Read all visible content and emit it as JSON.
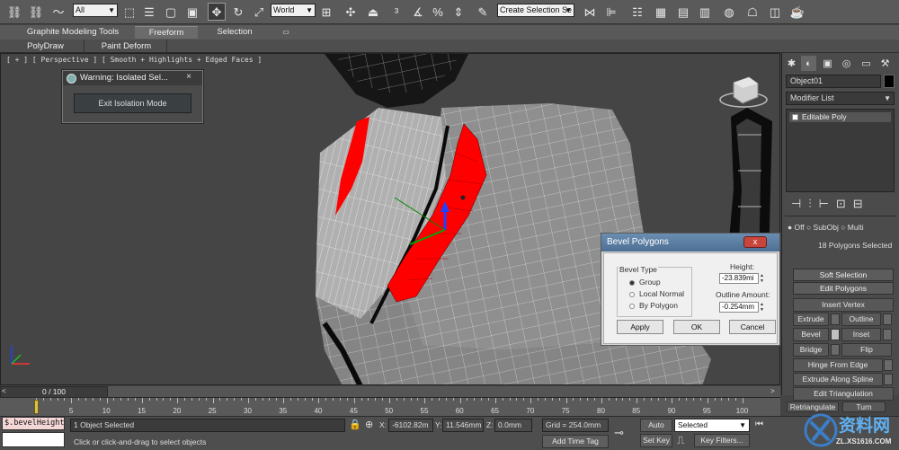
{
  "toolbar": {
    "filter_dropdown": "All",
    "coord_dropdown": "World",
    "named_selection": "Create Selection Se"
  },
  "ribbon": {
    "tabs": [
      "Graphite Modeling Tools",
      "Freeform",
      "Selection"
    ],
    "subtabs": [
      "PolyDraw",
      "Paint Deform"
    ]
  },
  "viewport": {
    "label": "[ + ] [ Perspective ] [ Smooth + Highlights + Edged Faces ]"
  },
  "isolation_dialog": {
    "title": "Warning: Isolated Sel...",
    "close": "×",
    "button": "Exit Isolation Mode"
  },
  "bevel_dialog": {
    "title": "Bevel Polygons",
    "close": "x",
    "group_label": "Bevel Type",
    "options": [
      "Group",
      "Local Normal",
      "By Polygon"
    ],
    "selected_option": "Group",
    "height_label": "Height:",
    "height_value": "-23.839mi",
    "outline_label": "Outline Amount:",
    "outline_value": "-0.254mm",
    "buttons": [
      "Apply",
      "OK",
      "Cancel"
    ]
  },
  "command_panel": {
    "object_name": "Object01",
    "modifier_list": "Modifier List",
    "stack_item": "Editable Poly",
    "soft_sel_options": "● Off  ○ SubObj  ○ Multi",
    "selection_count": "18 Polygons Selected",
    "soft_selection": "Soft Selection",
    "edit_polygons": "Edit Polygons",
    "insert_vertex": "Insert Vertex",
    "buttons": [
      "Extrude",
      "Outline",
      "Bevel",
      "Inset",
      "Bridge",
      "Flip"
    ],
    "hinge": "Hinge From Edge",
    "extrude_spline": "Extrude Along Spline",
    "edit_tri": "Edit Triangulation",
    "retriangulate": "Retriangulate",
    "turn": "Turn"
  },
  "timeline": {
    "frame_counter": "0 / 100",
    "ticks": [
      "0",
      "5",
      "10",
      "15",
      "20",
      "25",
      "30",
      "35",
      "40",
      "45",
      "50",
      "55",
      "60",
      "65",
      "70",
      "75",
      "80",
      "85",
      "90",
      "95",
      "100"
    ]
  },
  "status": {
    "maxscript": "$.bevelHeight :",
    "selected": "1 Object Selected",
    "prompt": "Click or click-and-drag to select objects",
    "x_label": "X:",
    "x_value": "-6102.82m",
    "y_label": "Y:",
    "y_value": "11.546mm",
    "z_label": "Z:",
    "z_value": "0.0mm",
    "grid": "Grid = 254.0mm",
    "add_time_tag": "Add Time Tag",
    "auto_key": "Auto Key",
    "set_key": "Set Key",
    "key_mode": "Selected",
    "key_filters": "Key Filters..."
  },
  "watermark": {
    "brand": "资料网",
    "url": "ZL.XS1616.COM"
  },
  "colors": {
    "selected_polygons": "#ff0000",
    "viewport_bg": "#454545",
    "mesh_fill": "#8c8c8c"
  }
}
